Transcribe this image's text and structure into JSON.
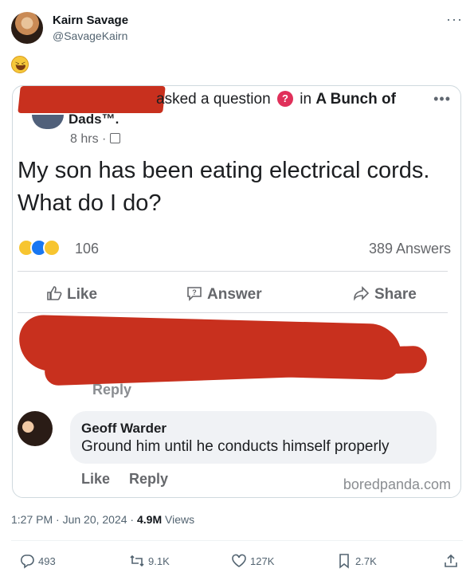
{
  "tweet": {
    "display_name": "Kairn Savage",
    "handle": "@SavageKairn",
    "more_glyph": "···",
    "emoji_icon": "rolling-on-floor-laughing-icon"
  },
  "screenshot": {
    "asked_text": "asked a question",
    "in_text": "in",
    "group_name": "A Bunch of",
    "group_tail": "Dads™.",
    "more_glyph": "•••",
    "post_time": "8 hrs ·",
    "question": "My son has been eating electrical cords. What do I do?",
    "reaction_count": "106",
    "answers_count": "389 Answers",
    "actions": {
      "like": "Like",
      "answer": "Answer",
      "share": "Share"
    },
    "reply_peek": "Reply",
    "comment": {
      "author": "Geoff Warder",
      "text": "Ground him until he conducts himself properly",
      "like": "Like",
      "reply": "Reply"
    },
    "watermark": "boredpanda.com",
    "redaction_color": "#c8301e"
  },
  "meta": {
    "time": "1:27 PM · Jun 20, 2024 ·",
    "views_count": "4.9M",
    "views_label": "Views"
  },
  "stats": {
    "replies": "493",
    "retweets": "9.1K",
    "likes": "127K",
    "bookmarks": "2.7K"
  }
}
